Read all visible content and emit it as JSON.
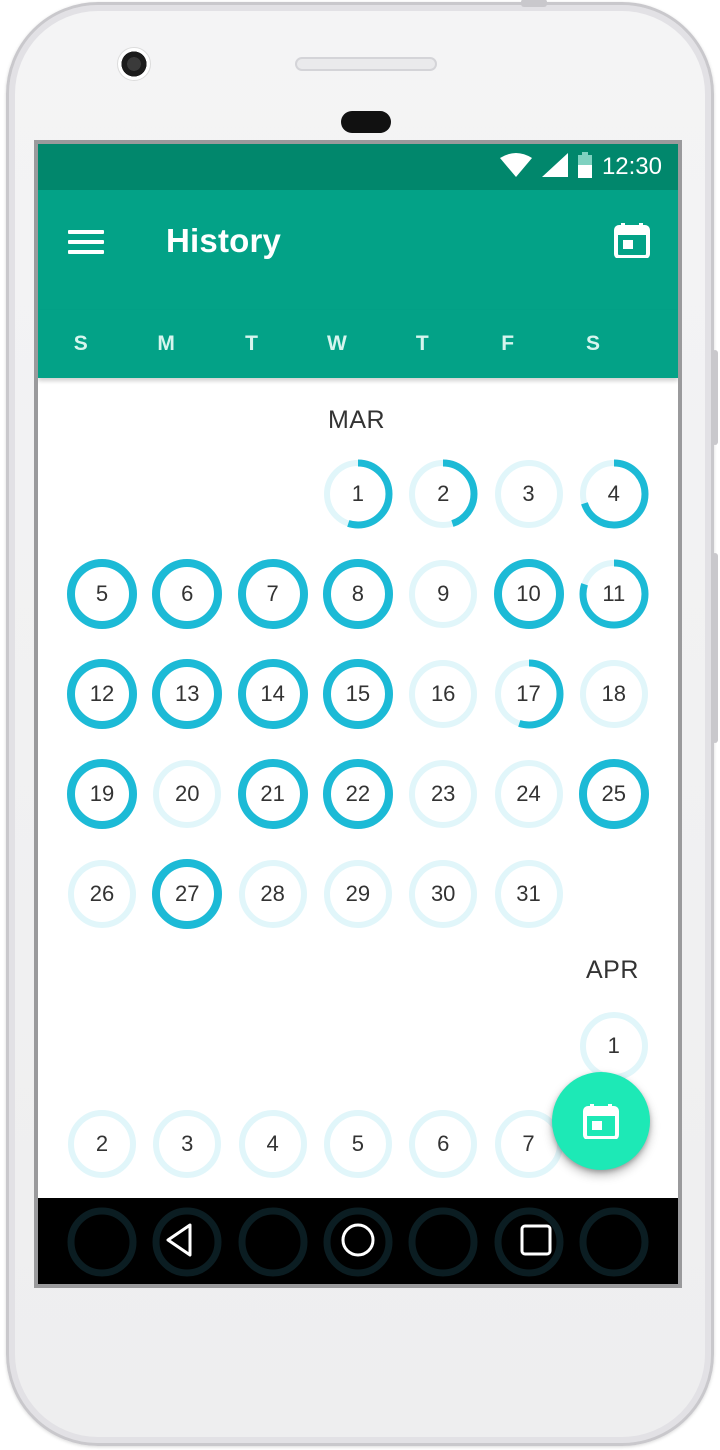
{
  "status_bar": {
    "time": "12:30",
    "icons": [
      "wifi-icon",
      "signal-icon",
      "battery-icon"
    ]
  },
  "app_bar": {
    "title": "History",
    "left_icon": "menu-icon",
    "right_icon": "calendar-icon"
  },
  "weekdays": [
    "S",
    "M",
    "T",
    "W",
    "T",
    "F",
    "S"
  ],
  "months": [
    {
      "label": "MAR",
      "days": [
        {
          "day": "1",
          "progress": 0.55
        },
        {
          "day": "2",
          "progress": 0.45
        },
        {
          "day": "3",
          "progress": 0
        },
        {
          "day": "4",
          "progress": 0.7
        },
        {
          "day": "5",
          "progress": 1
        },
        {
          "day": "6",
          "progress": 1
        },
        {
          "day": "7",
          "progress": 1
        },
        {
          "day": "8",
          "progress": 1
        },
        {
          "day": "9",
          "progress": 0
        },
        {
          "day": "10",
          "progress": 1
        },
        {
          "day": "11",
          "progress": 0.8
        },
        {
          "day": "12",
          "progress": 1
        },
        {
          "day": "13",
          "progress": 1
        },
        {
          "day": "14",
          "progress": 1
        },
        {
          "day": "15",
          "progress": 1
        },
        {
          "day": "16",
          "progress": 0
        },
        {
          "day": "17",
          "progress": 0.55
        },
        {
          "day": "18",
          "progress": 0
        },
        {
          "day": "19",
          "progress": 1
        },
        {
          "day": "20",
          "progress": 0
        },
        {
          "day": "21",
          "progress": 1
        },
        {
          "day": "22",
          "progress": 1
        },
        {
          "day": "23",
          "progress": 0
        },
        {
          "day": "24",
          "progress": 0
        },
        {
          "day": "25",
          "progress": 1
        },
        {
          "day": "26",
          "progress": 0
        },
        {
          "day": "27",
          "progress": 1
        },
        {
          "day": "28",
          "progress": 0
        },
        {
          "day": "29",
          "progress": 0
        },
        {
          "day": "30",
          "progress": 0
        },
        {
          "day": "31",
          "progress": 0
        }
      ]
    },
    {
      "label": "APR",
      "days": [
        {
          "day": "1",
          "progress": 0
        },
        {
          "day": "2",
          "progress": 0
        },
        {
          "day": "3",
          "progress": 0
        },
        {
          "day": "4",
          "progress": 0
        },
        {
          "day": "5",
          "progress": 0
        },
        {
          "day": "6",
          "progress": 0
        },
        {
          "day": "7",
          "progress": 0
        }
      ]
    }
  ],
  "fab_icon": "calendar-icon",
  "nav_bar": {
    "buttons": [
      "back-icon",
      "home-icon",
      "recents-icon"
    ]
  },
  "colors": {
    "status_bar": "#01876c",
    "app_bar": "#03a287",
    "ring": "#1cbad6",
    "ring_track": "#e1f6fa",
    "fab": "#1de9b6"
  }
}
